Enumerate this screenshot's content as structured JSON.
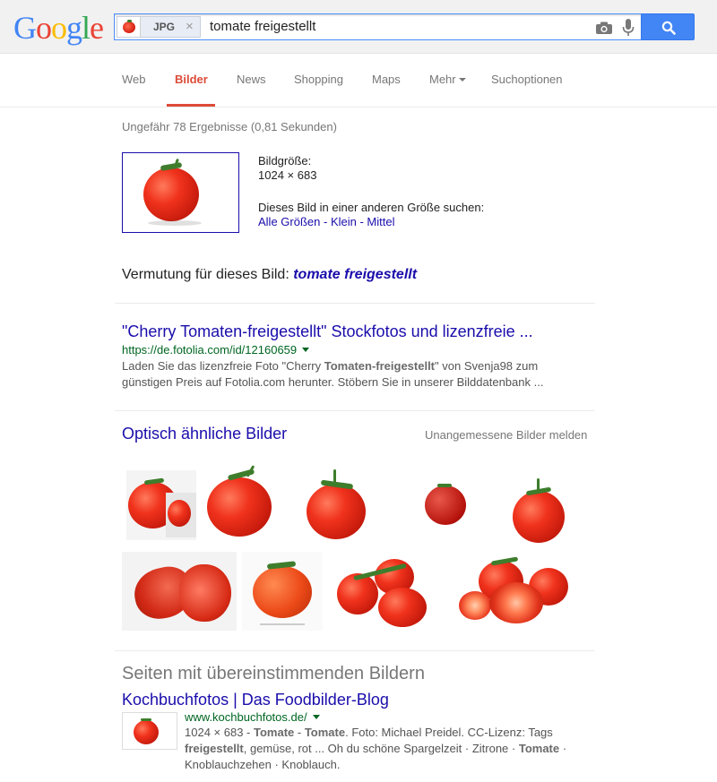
{
  "logo": {
    "letters": [
      "G",
      "o",
      "o",
      "g",
      "l",
      "e"
    ],
    "colors": [
      "#4285f4",
      "#ea4335",
      "#fbbc05",
      "#4285f4",
      "#34a853",
      "#ea4335"
    ]
  },
  "search": {
    "chip_label": "JPG",
    "chip_close": "×",
    "query": "tomate freigestellt"
  },
  "nav": {
    "items": [
      "Web",
      "Bilder",
      "News",
      "Shopping",
      "Maps",
      "Mehr",
      "Suchoptionen"
    ],
    "active": "Bilder"
  },
  "stats": "Ungefähr 78 Ergebnisse (0,81 Sekunden)",
  "image_info": {
    "size_label": "Bildgröße:",
    "size_value": "1024 × 683",
    "other_sizes_label": "Dieses Bild in einer anderen Größe suchen:",
    "size_links": [
      "Alle Größen",
      "Klein",
      "Mittel"
    ],
    "separator": " - "
  },
  "guess": {
    "prefix": "Vermutung für dieses Bild: ",
    "term": "tomate freigestellt"
  },
  "result": {
    "title": "\"Cherry Tomaten-freigestellt\" Stockfotos und lizenzfreie ...",
    "url": "https://de.fotolia.com/id/12160659",
    "snippet_1": "Laden Sie das lizenzfreie Foto \"Cherry ",
    "snippet_bold": "Tomaten-freigestellt",
    "snippet_2": "\" von Svenja98 zum günstigen Preis auf Fotolia.com herunter. Stöbern Sie in unserer Bilddatenbank ..."
  },
  "similar": {
    "title": "Optisch ähnliche Bilder",
    "report": "Unangemessene Bilder melden"
  },
  "pages": {
    "title": "Seiten mit übereinstimmenden Bildern",
    "result_title": "Kochbuchfotos | Das Foodbilder-Blog",
    "url": "www.kochbuchfotos.de/",
    "size": "1024 × 683",
    "dash": " - ",
    "b1": "Tomate",
    "t1": " - ",
    "b2": "Tomate",
    "t2": ". Foto: Michael Preidel. CC-Lizenz: Tags ",
    "b3": "freigestellt",
    "t3": ", gemüse, rot ... Oh du schöne Spargelzeit · Zitrone · ",
    "b4": "Tomate",
    "t4": " · Knoblauchzehen · Knoblauch."
  }
}
